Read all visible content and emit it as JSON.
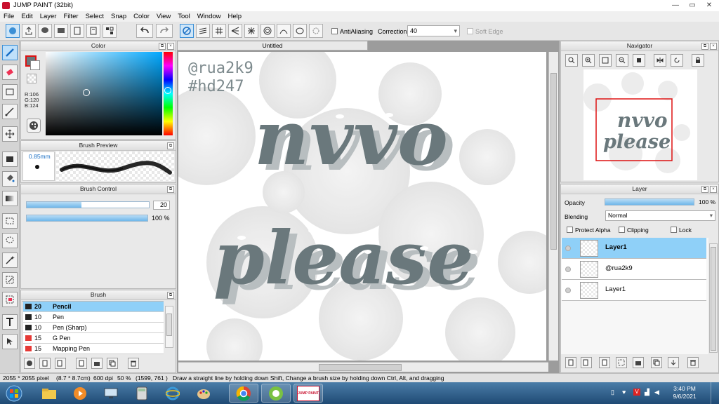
{
  "window": {
    "title": "JUMP PAINT (32bit)",
    "min": "—",
    "max": "▭",
    "close": "✕"
  },
  "menu": [
    "File",
    "Edit",
    "Layer",
    "Filter",
    "Select",
    "Snap",
    "Color",
    "View",
    "Tool",
    "Window",
    "Help"
  ],
  "toolbar": {
    "antialiasing_label": "AntiAliasing",
    "correction_label": "Correction",
    "correction_value": "40",
    "soft_edge_label": "Soft Edge"
  },
  "panels": {
    "color": {
      "title": "Color",
      "r": "R:106",
      "g": "G:120",
      "b": "B:124",
      "main_color": "#6a787c"
    },
    "brush_preview": {
      "title": "Brush Preview",
      "size": "0.85mm"
    },
    "brush_control": {
      "title": "Brush Control",
      "size_value": "20",
      "size_fill": 0.45,
      "opacity_value": "100 %",
      "opacity_fill": 1.0
    },
    "brush": {
      "title": "Brush",
      "items": [
        {
          "size": "20",
          "name": "Pencil",
          "color": "#222222",
          "selected": true
        },
        {
          "size": "10",
          "name": "Pen",
          "color": "#222222",
          "selected": false
        },
        {
          "size": "10",
          "name": "Pen (Sharp)",
          "color": "#222222",
          "selected": false
        },
        {
          "size": "15",
          "name": "G Pen",
          "color": "#e53935",
          "selected": false
        },
        {
          "size": "15",
          "name": "Mapping Pen",
          "color": "#e53935",
          "selected": false
        }
      ]
    },
    "navigator": {
      "title": "Navigator"
    },
    "layer": {
      "title": "Layer",
      "opacity_label": "Opacity",
      "opacity_value": "100 %",
      "opacity_fill": 1.0,
      "blending_label": "Blending",
      "blending_value": "Normal",
      "protect_alpha": "Protect Alpha",
      "clipping": "Clipping",
      "lock": "Lock",
      "layers": [
        {
          "name": "Layer1",
          "selected": true
        },
        {
          "name": "@rua2k9",
          "selected": false
        },
        {
          "name": "Layer1",
          "selected": false
        }
      ]
    }
  },
  "canvas": {
    "tab": "Untitled",
    "watermark_line1": "@rua2k9",
    "watermark_line2": "#hd247",
    "word1": "nvvo",
    "word2": "please",
    "ink": "#6a787c",
    "shadow": "#b8bec0"
  },
  "status": {
    "size": "2055 * 2055 pixel",
    "physical": "(8.7 * 8.7cm)",
    "dpi": "600 dpi",
    "zoom": "50 %",
    "coords": "(1599, 761 )",
    "hint": "Draw a straight line by holding down Shift, Change a brush size by holding down Ctrl, Alt, and dragging"
  },
  "taskbar": {
    "time": "3:40 PM",
    "date": "9/6/2021",
    "jump_label": "JUMP PAINT"
  }
}
